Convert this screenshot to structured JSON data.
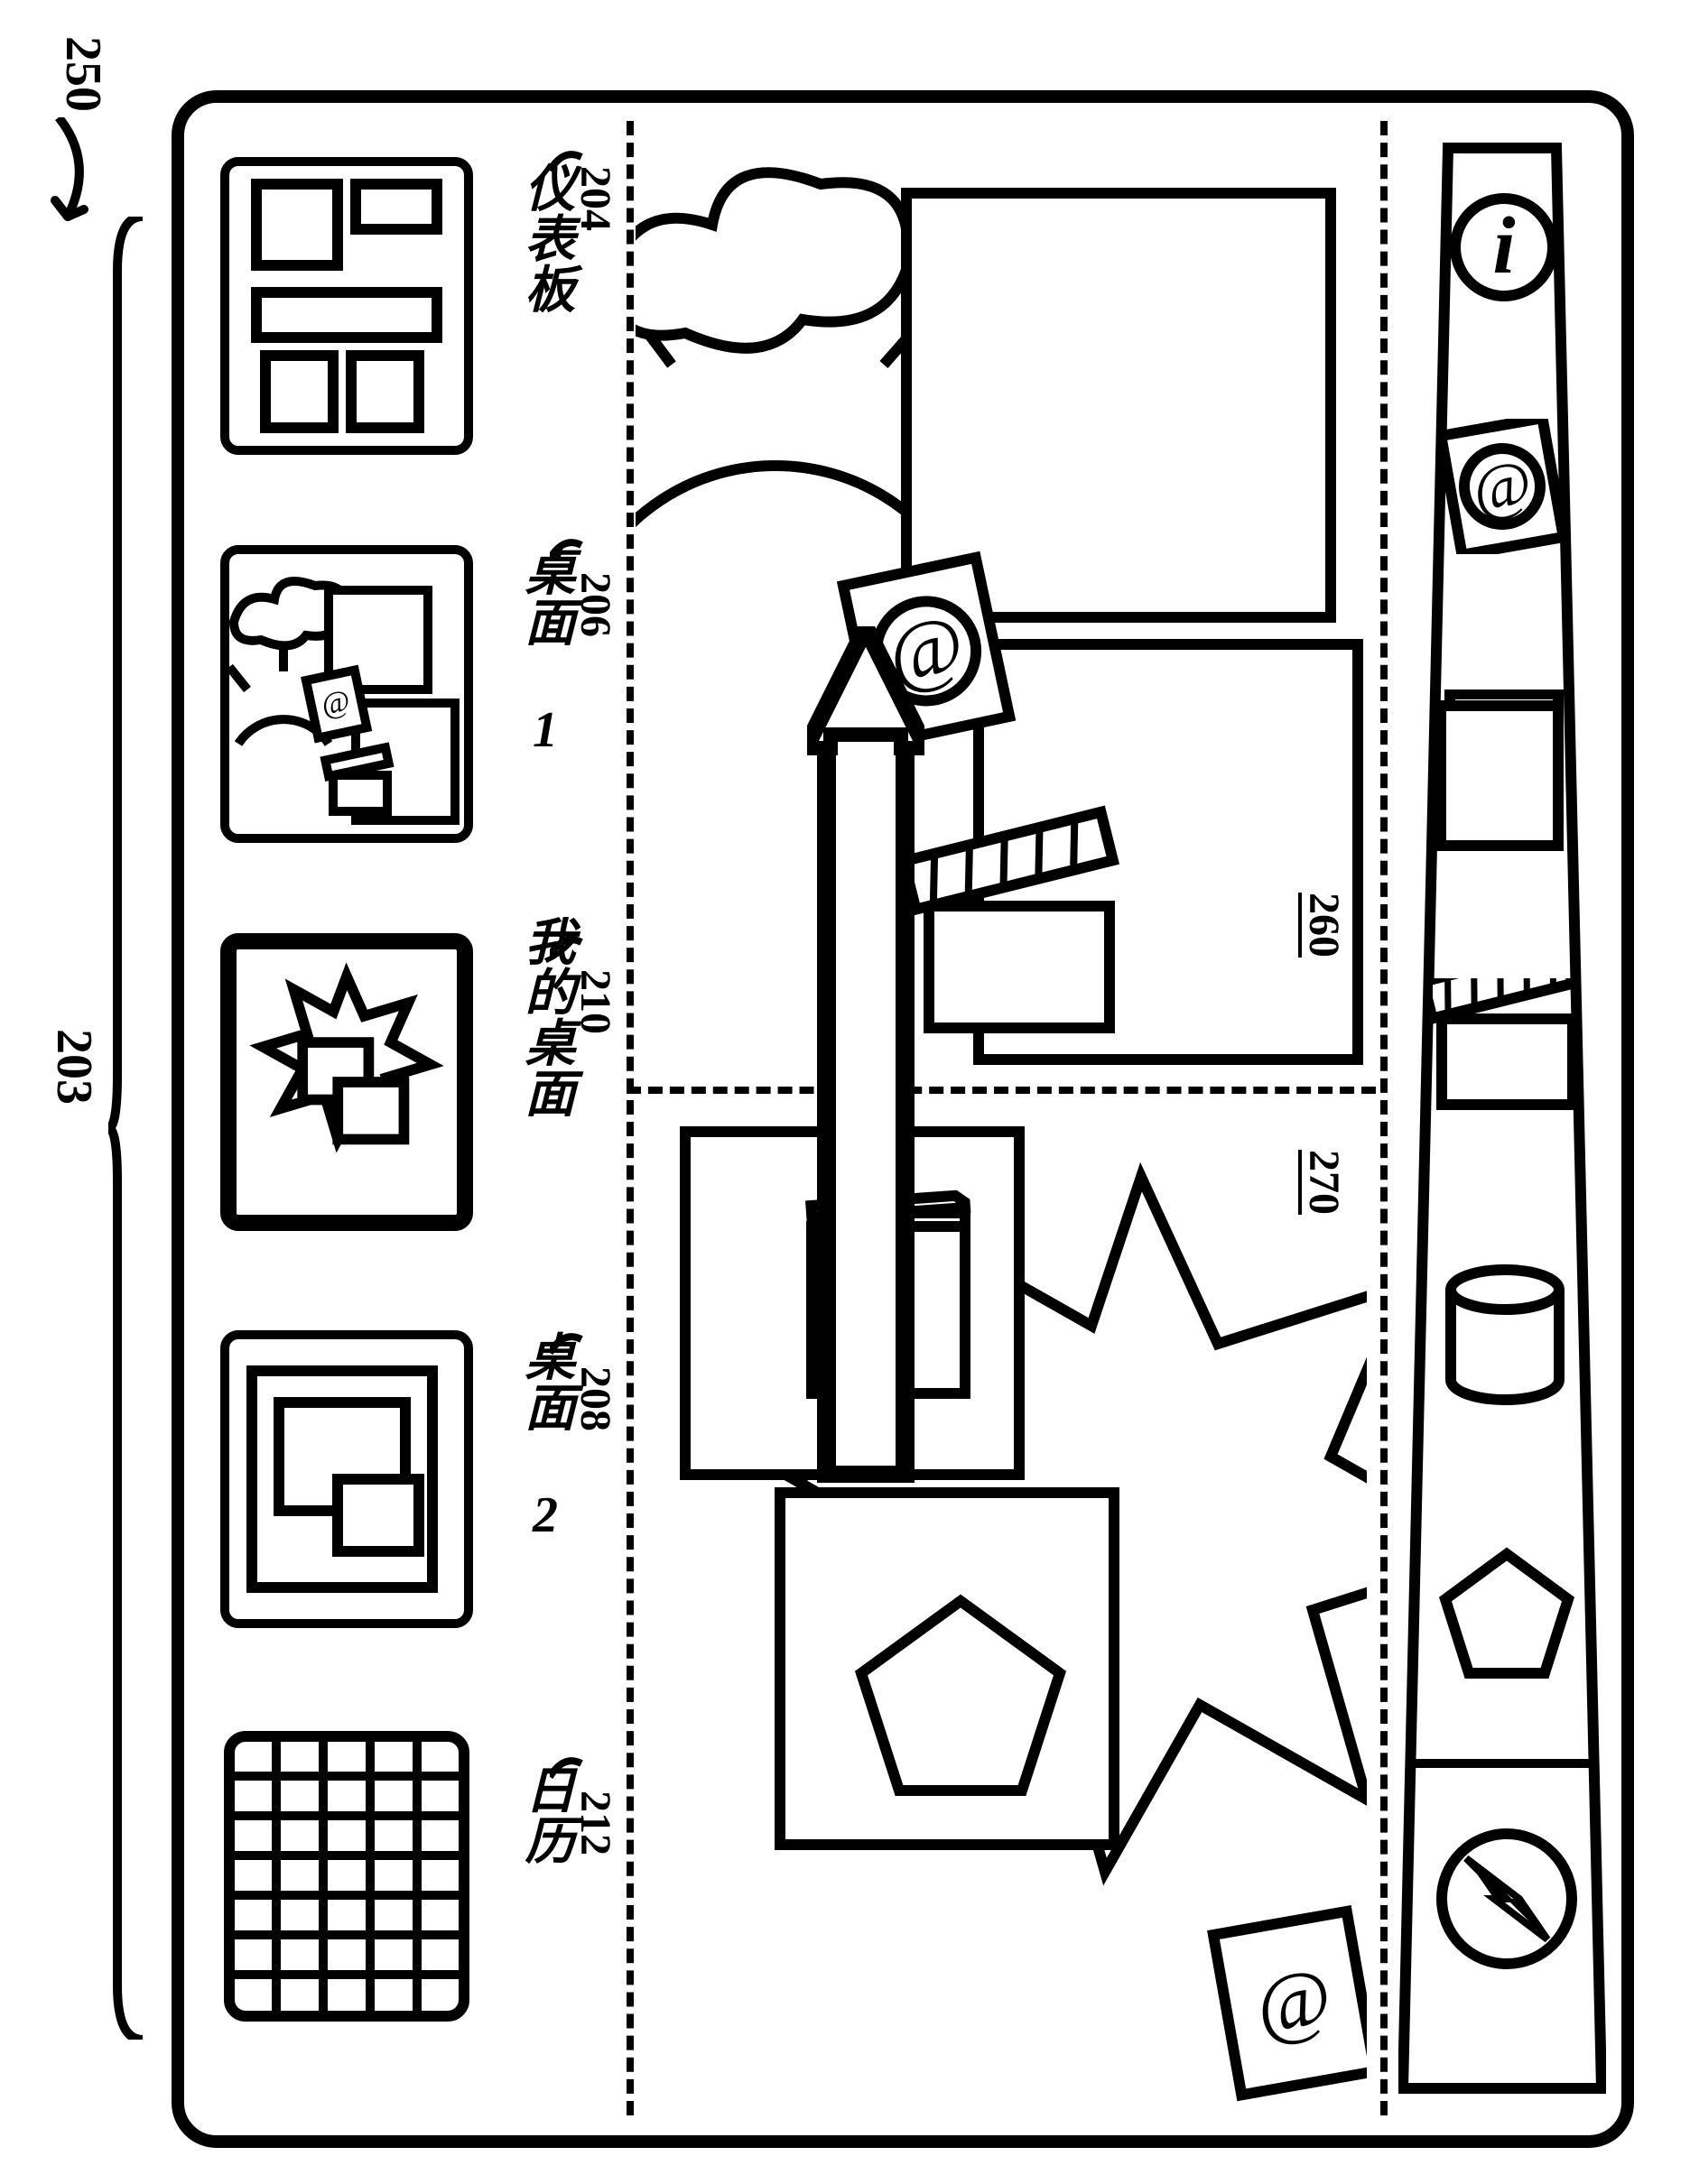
{
  "figure_ref": "250",
  "thumb_strip_ref": "203",
  "thumbs": {
    "dashboard": {
      "label": "仪表板",
      "ref": "204"
    },
    "desktop1": {
      "label": "桌面 1",
      "ref": "206"
    },
    "mydesktop": {
      "label": "我的桌面",
      "ref": "210"
    },
    "desktop2": {
      "label": "桌面 2",
      "ref": "208"
    },
    "calendar": {
      "label": "日历",
      "ref": "212"
    }
  },
  "refs": {
    "left_panel_ref": "260",
    "right_panel_ref": "270"
  }
}
